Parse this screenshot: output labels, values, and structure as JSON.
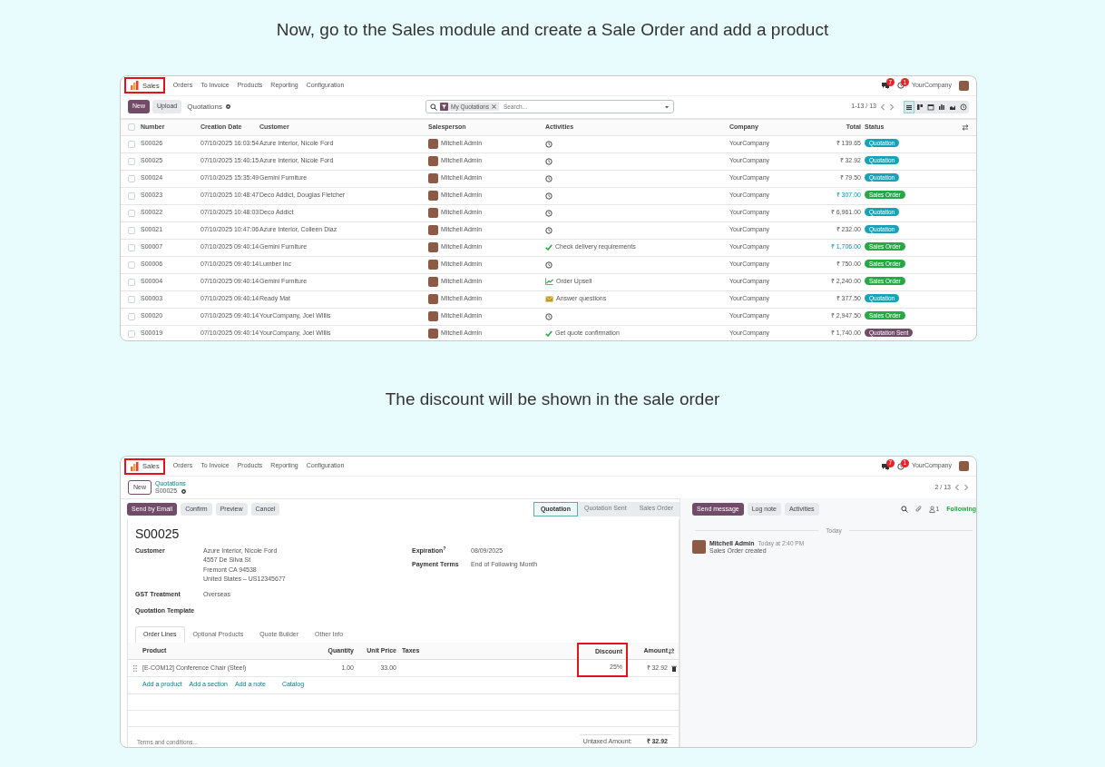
{
  "heading_1": "Now, go to the Sales module and create a Sale Order and add a product",
  "list_view": {
    "app_menu": {
      "app": "Sales",
      "highlighted": true
    },
    "menu": [
      "Orders",
      "To Invoice",
      "Products",
      "Reporting",
      "Configuration"
    ],
    "systray": {
      "messages_count": "7",
      "activities_count": "1",
      "company": "YourCompany"
    },
    "buttons": [
      {
        "label": "New",
        "primary": true
      },
      {
        "label": "Upload",
        "primary": false
      }
    ],
    "title": "Quotations",
    "search": {
      "facet": "My Quotations",
      "placeholder": "Search..."
    },
    "pager": "1-13 / 13",
    "views": [
      {
        "kind": "list",
        "selected": true
      },
      {
        "kind": "kanban",
        "selected": false
      },
      {
        "kind": "calendar",
        "selected": false
      },
      {
        "kind": "pivot",
        "selected": false
      },
      {
        "kind": "graph",
        "selected": false
      },
      {
        "kind": "activity",
        "selected": false
      }
    ],
    "select_all_checked": false,
    "columns": [
      "Number",
      "Creation Date",
      "Customer",
      "Salesperson",
      "Activities",
      "Company",
      "Total",
      "Status"
    ],
    "rows": [
      {
        "checked": false,
        "number": "S00026",
        "date": "07/10/2025 16:03:54",
        "customer": "Azure Interior, Nicole Ford",
        "salesperson": "Mitchell Admin",
        "activity": {
          "kind": "clock"
        },
        "company": "YourCompany",
        "total": "₹ 139.65",
        "total_highlighted": false,
        "status": {
          "label": "Quotation",
          "color": "#17a2b8"
        }
      },
      {
        "checked": false,
        "number": "S00025",
        "date": "07/10/2025 15:40:15",
        "customer": "Azure Interior, Nicole Ford",
        "salesperson": "Mitchell Admin",
        "activity": {
          "kind": "clock"
        },
        "company": "YourCompany",
        "total": "₹ 32.92",
        "total_highlighted": false,
        "status": {
          "label": "Quotation",
          "color": "#17a2b8"
        }
      },
      {
        "checked": false,
        "number": "S00024",
        "date": "07/10/2025 15:35:49",
        "customer": "Gemini Furniture",
        "salesperson": "Mitchell Admin",
        "activity": {
          "kind": "clock"
        },
        "company": "YourCompany",
        "total": "₹ 79.50",
        "total_highlighted": false,
        "status": {
          "label": "Quotation",
          "color": "#17a2b8"
        }
      },
      {
        "checked": false,
        "number": "S00023",
        "date": "07/10/2025 10:48:47",
        "customer": "Deco Addict, Douglas Fletcher",
        "salesperson": "Mitchell Admin",
        "activity": {
          "kind": "clock"
        },
        "company": "YourCompany",
        "total": "₹ 307.00",
        "total_highlighted": true,
        "status": {
          "label": "Sales Order",
          "color": "#28a745"
        }
      },
      {
        "checked": false,
        "number": "S00022",
        "date": "07/10/2025 10:48:03",
        "customer": "Deco Addict",
        "salesperson": "Mitchell Admin",
        "activity": {
          "kind": "clock"
        },
        "company": "YourCompany",
        "total": "₹ 6,961.00",
        "total_highlighted": false,
        "status": {
          "label": "Quotation",
          "color": "#17a2b8"
        }
      },
      {
        "checked": false,
        "number": "S00021",
        "date": "07/10/2025 10:47:06",
        "customer": "Azure Interior, Colleen Diaz",
        "salesperson": "Mitchell Admin",
        "activity": {
          "kind": "clock"
        },
        "company": "YourCompany",
        "total": "₹ 232.00",
        "total_highlighted": false,
        "status": {
          "label": "Quotation",
          "color": "#17a2b8"
        }
      },
      {
        "checked": false,
        "number": "S00007",
        "date": "07/10/2025 09:40:14",
        "customer": "Gemini Furniture",
        "salesperson": "Mitchell Admin",
        "activity": {
          "kind": "check",
          "text": "Check delivery requirements"
        },
        "company": "YourCompany",
        "total": "₹ 1,706.00",
        "total_highlighted": true,
        "status": {
          "label": "Sales Order",
          "color": "#28a745"
        }
      },
      {
        "checked": false,
        "number": "S00006",
        "date": "07/10/2025 09:40:14",
        "customer": "Lumber Inc",
        "salesperson": "Mitchell Admin",
        "activity": {
          "kind": "clock"
        },
        "company": "YourCompany",
        "total": "₹ 750.00",
        "total_highlighted": false,
        "status": {
          "label": "Sales Order",
          "color": "#28a745"
        }
      },
      {
        "checked": false,
        "number": "S00004",
        "date": "07/10/2025 09:40:14",
        "customer": "Gemini Furniture",
        "salesperson": "Mitchell Admin",
        "activity": {
          "kind": "upsell",
          "text": "Order Upsell"
        },
        "company": "YourCompany",
        "total": "₹ 2,240.00",
        "total_highlighted": false,
        "status": {
          "label": "Sales Order",
          "color": "#28a745"
        }
      },
      {
        "checked": false,
        "number": "S00003",
        "date": "07/10/2025 09:40:14",
        "customer": "Ready Mat",
        "salesperson": "Mitchell Admin",
        "activity": {
          "kind": "email",
          "text": "Answer questions"
        },
        "company": "YourCompany",
        "total": "₹ 377.50",
        "total_highlighted": false,
        "status": {
          "label": "Quotation",
          "color": "#17a2b8"
        }
      },
      {
        "checked": false,
        "number": "S00020",
        "date": "07/10/2025 09:40:14",
        "customer": "YourCompany, Joel Willis",
        "salesperson": "Mitchell Admin",
        "activity": {
          "kind": "clock"
        },
        "company": "YourCompany",
        "total": "₹ 2,947.50",
        "total_highlighted": false,
        "status": {
          "label": "Sales Order",
          "color": "#28a745"
        }
      },
      {
        "checked": false,
        "number": "S00019",
        "date": "07/10/2025 09:40:14",
        "customer": "YourCompany, Joel Willis",
        "salesperson": "Mitchell Admin",
        "activity": {
          "kind": "check",
          "text": "Get quote confirmation"
        },
        "company": "YourCompany",
        "total": "₹ 1,740.00",
        "total_highlighted": false,
        "status": {
          "label": "Quotation Sent",
          "color": "#714b67"
        }
      }
    ]
  },
  "heading_2": "The discount will be shown in the sale order",
  "form_view": {
    "app_menu": {
      "app": "Sales",
      "highlighted": true
    },
    "menu": [
      "Orders",
      "To Invoice",
      "Products",
      "Reporting",
      "Configuration"
    ],
    "systray": {
      "messages_count": "7",
      "activities_count": "1",
      "company": "YourCompany"
    },
    "new_button": "New",
    "breadcrumb": {
      "parent": "Quotations",
      "current": "S00025"
    },
    "pager": "2 / 13",
    "actions": [
      {
        "label": "Send by Email",
        "primary": true
      },
      {
        "label": "Confirm",
        "primary": false
      },
      {
        "label": "Preview",
        "primary": false
      },
      {
        "label": "Cancel",
        "primary": false
      }
    ],
    "stages": [
      {
        "label": "Quotation",
        "selected": true
      },
      {
        "label": "Quotation Sent",
        "selected": false
      },
      {
        "label": "Sales Order",
        "selected": false
      }
    ],
    "record_name": "S00025",
    "fields_left": [
      {
        "label": "Customer",
        "value_lines": [
          "Azure Interior, Nicole Ford",
          "4557 De Silva St",
          "Fremont CA 94538",
          "United States – US12345677"
        ]
      },
      {
        "label": "GST Treatment",
        "value_lines": [
          "Overseas"
        ]
      },
      {
        "label": "Quotation Template"
      }
    ],
    "fields_right": [
      {
        "label": "Expiration$^{?}$",
        "value": "08/09/2025"
      },
      {
        "label": "Payment Terms",
        "value": "End of Following Month"
      }
    ],
    "tabs": [
      {
        "label": "Order Lines",
        "selected": true
      },
      {
        "label": "Optional Products",
        "selected": false
      },
      {
        "label": "Quote Builder",
        "selected": false
      },
      {
        "label": "Other Info",
        "selected": false
      }
    ],
    "line_columns": [
      {
        "label": "Product",
        "highlighted": false
      },
      {
        "label": "Quantity",
        "highlighted": false
      },
      {
        "label": "Unit Price",
        "highlighted": false
      },
      {
        "label": "Taxes",
        "highlighted": false
      },
      {
        "label": "Discount",
        "highlighted": true
      },
      {
        "label": "Amount",
        "highlighted": false
      }
    ],
    "lines": [
      {
        "product": "[E-COM12] Conference Chair (Steel)",
        "quantity": "1.00",
        "unit_price": "33.00",
        "discount": "25%",
        "amount": "₹ 32.92"
      }
    ],
    "add_links": [
      "Add a product",
      "Add a section",
      "Add a note",
      "Catalog"
    ],
    "terms_placeholder": "Terms and conditions...",
    "untaxed": {
      "label": "Untaxed Amount:",
      "value": "₹ 32.92"
    },
    "chatter": {
      "buttons": [
        {
          "label": "Send message",
          "primary": true
        },
        {
          "label": "Log note",
          "primary": false
        },
        {
          "label": "Activities",
          "primary": false
        }
      ],
      "followers_count": "1",
      "following_label": "Following",
      "date_separator": "Today",
      "messages": [
        {
          "author": "Mitchell Admin",
          "time": "Today at 2:40 PM",
          "body": "Sales Order created"
        }
      ]
    }
  }
}
